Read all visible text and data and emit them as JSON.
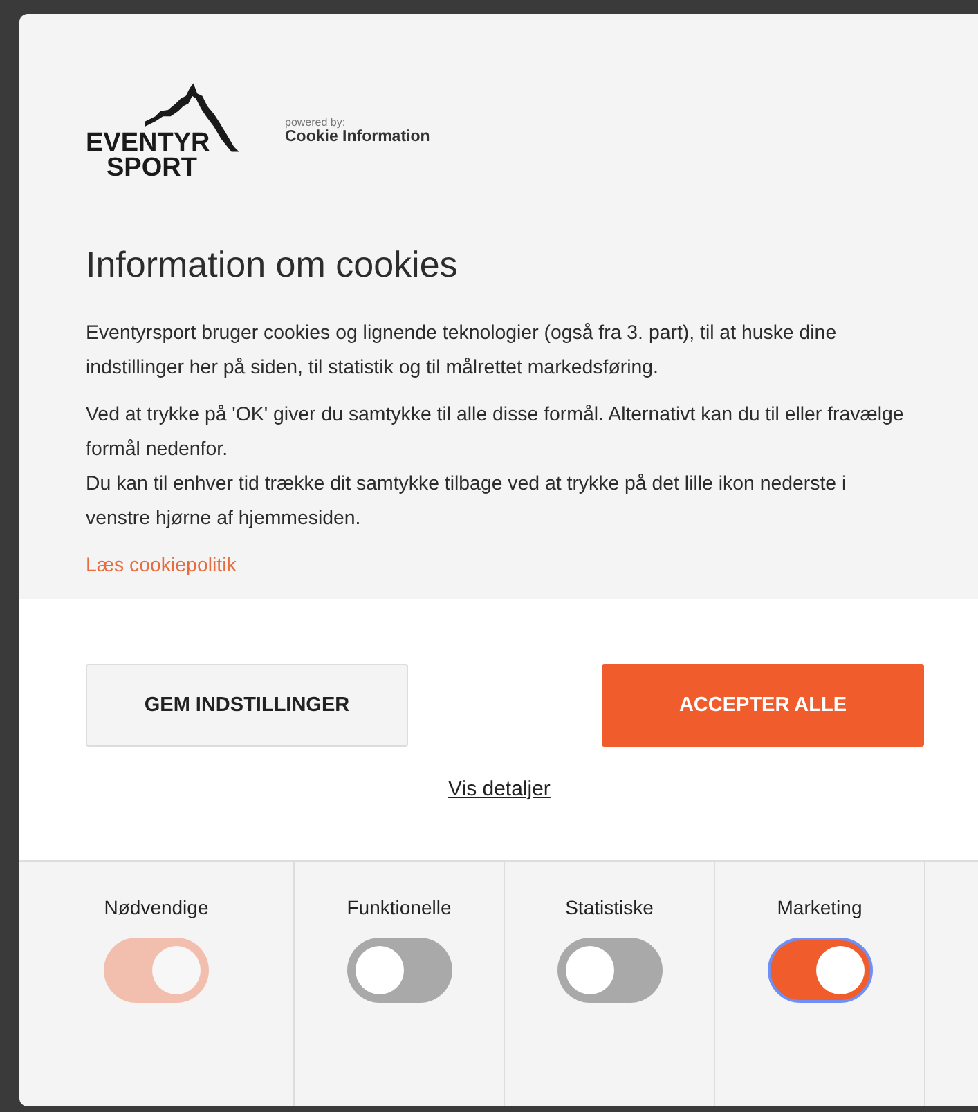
{
  "logo": {
    "line_1": "EVENTYR",
    "line_2": "SPORT",
    "powered_by": "powered by:",
    "provider": "Cookie Information"
  },
  "title": "Information om cookies",
  "paragraphs": [
    "Eventyrsport bruger cookies og lignende teknologier (også fra 3. part), til at huske dine indstillinger her på siden, til statistik og til målrettet markedsføring.",
    "Ved at trykke på 'OK' giver du samtykke til alle disse formål. Alternativt kan du til eller fravælge formål nedenfor.\nDu kan til enhver tid trække dit samtykke tilbage ved at trykke på det lille ikon nederste i venstre hjørne af hjemmesiden."
  ],
  "policy_link": "Læs cookiepolitik",
  "buttons": [
    {
      "label": "GEM INDSTILLINGER",
      "kind": "secondary"
    },
    {
      "label": "ACCEPTER ALLE",
      "kind": "primary"
    }
  ],
  "details_link": "Vis detaljer",
  "categories": [
    {
      "label": "Nødvendige",
      "checked": true,
      "disabled": true,
      "focused": false
    },
    {
      "label": "Funktionelle",
      "checked": false,
      "disabled": false,
      "focused": false
    },
    {
      "label": "Statistiske",
      "checked": false,
      "disabled": false,
      "focused": false
    },
    {
      "label": "Marketing",
      "checked": true,
      "disabled": false,
      "focused": true
    }
  ]
}
